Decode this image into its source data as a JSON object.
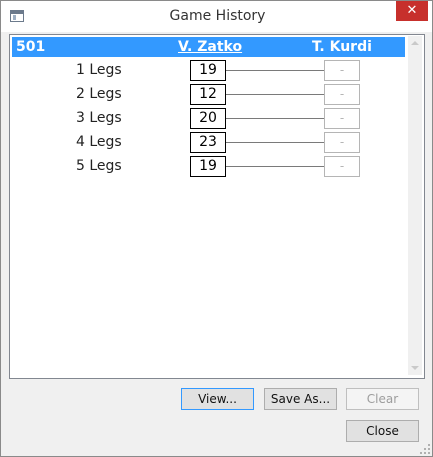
{
  "window": {
    "title": "Game History",
    "close_glyph": "✕"
  },
  "table": {
    "header": {
      "game": "501",
      "player1": "V. Zatko",
      "player2": "T. Kurdi"
    },
    "rows": [
      {
        "label": "1 Legs",
        "p1": "19",
        "p2": "-"
      },
      {
        "label": "2 Legs",
        "p1": "12",
        "p2": "-"
      },
      {
        "label": "3 Legs",
        "p1": "20",
        "p2": "-"
      },
      {
        "label": "4 Legs",
        "p1": "23",
        "p2": "-"
      },
      {
        "label": "5 Legs",
        "p1": "19",
        "p2": "-"
      }
    ]
  },
  "buttons": {
    "view": "View...",
    "save_as": "Save As...",
    "clear": "Clear",
    "close": "Close"
  },
  "colors": {
    "header_bg": "#3399ff",
    "close_bg": "#c7302c"
  }
}
